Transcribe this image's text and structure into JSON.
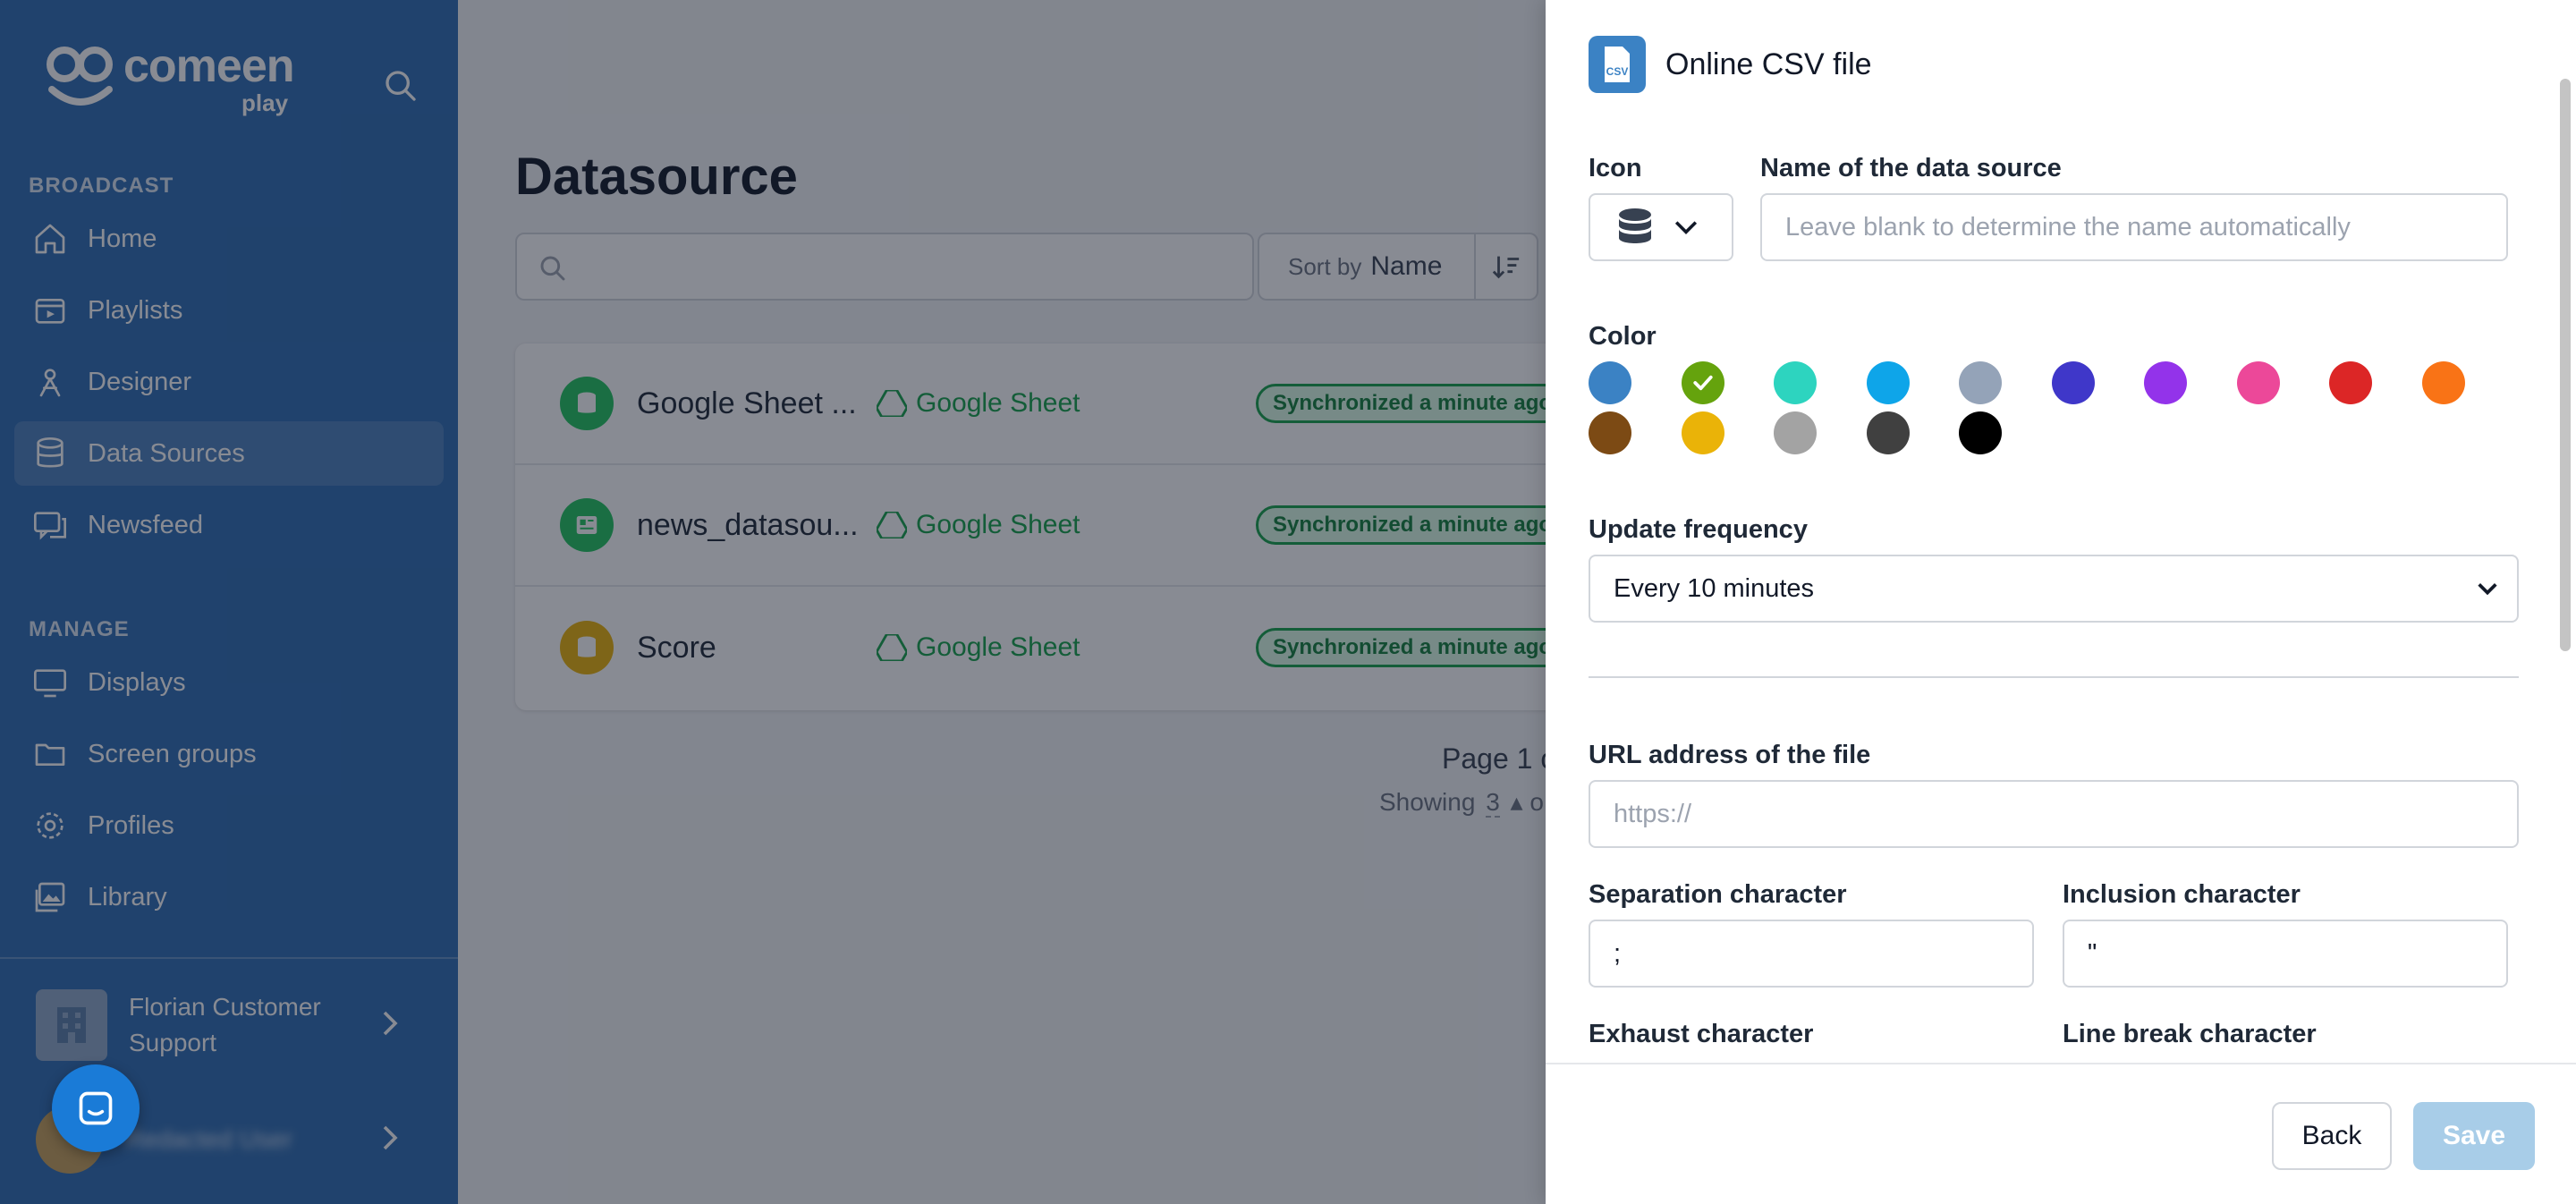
{
  "sidebar": {
    "logo_word": "comeen",
    "logo_sub": "play",
    "section_broadcast": "BROADCAST",
    "section_manage": "MANAGE",
    "broadcast_items": [
      {
        "label": "Home",
        "icon": "home-icon"
      },
      {
        "label": "Playlists",
        "icon": "playlist-icon"
      },
      {
        "label": "Designer",
        "icon": "designer-icon"
      },
      {
        "label": "Data Sources",
        "icon": "database-icon",
        "active": true
      },
      {
        "label": "Newsfeed",
        "icon": "newsfeed-icon"
      }
    ],
    "manage_items": [
      {
        "label": "Displays",
        "icon": "monitor-icon"
      },
      {
        "label": "Screen groups",
        "icon": "folder-icon"
      },
      {
        "label": "Profiles",
        "icon": "gear-icon"
      },
      {
        "label": "Library",
        "icon": "image-library-icon"
      }
    ],
    "organization": "Florian Customer Support",
    "user_name": "Redacted User"
  },
  "main": {
    "title": "Datasource",
    "search_placeholder": "",
    "sort_by_label": "Sort by",
    "sort_value": "Name",
    "rows": [
      {
        "name": "Google Sheet ...",
        "type": "Google Sheet",
        "status": "Synchronized a minute ago",
        "icon_color": "#22c55e"
      },
      {
        "name": "news_datasou...",
        "type": "Google Sheet",
        "status": "Synchronized a minute ago",
        "icon_color": "#22c55e"
      },
      {
        "name": "Score",
        "type": "Google Sheet",
        "status": "Synchronized a minute ago",
        "icon_color": "#eab308"
      }
    ],
    "page_info": "Page 1 o",
    "showing_prefix": "Showing",
    "showing_count": "3",
    "showing_suffix": "o"
  },
  "drawer": {
    "title": "Online CSV file",
    "icon_label": "Icon",
    "name_label": "Name of the data source",
    "name_placeholder": "Leave blank to determine the name automatically",
    "color_label": "Color",
    "colors": [
      "#3b82c4",
      "#65a30d",
      "#2dd4bf",
      "#0ea5e9",
      "#94a3b8",
      "#3f37c9",
      "#9333ea",
      "#ec4899",
      "#dc2626",
      "#f97316",
      "#7c4a14",
      "#eab308",
      "#a3a3a3",
      "#404040",
      "#000000"
    ],
    "selected_color_index": 1,
    "frequency_label": "Update frequency",
    "frequency_value": "Every 10 minutes",
    "url_label": "URL address of the file",
    "url_placeholder": "https://",
    "separation_label": "Separation character",
    "separation_value": ";",
    "inclusion_label": "Inclusion character",
    "inclusion_value": "\"",
    "exhaust_label": "Exhaust character",
    "linebreak_label": "Line break character",
    "back_label": "Back",
    "save_label": "Save"
  }
}
